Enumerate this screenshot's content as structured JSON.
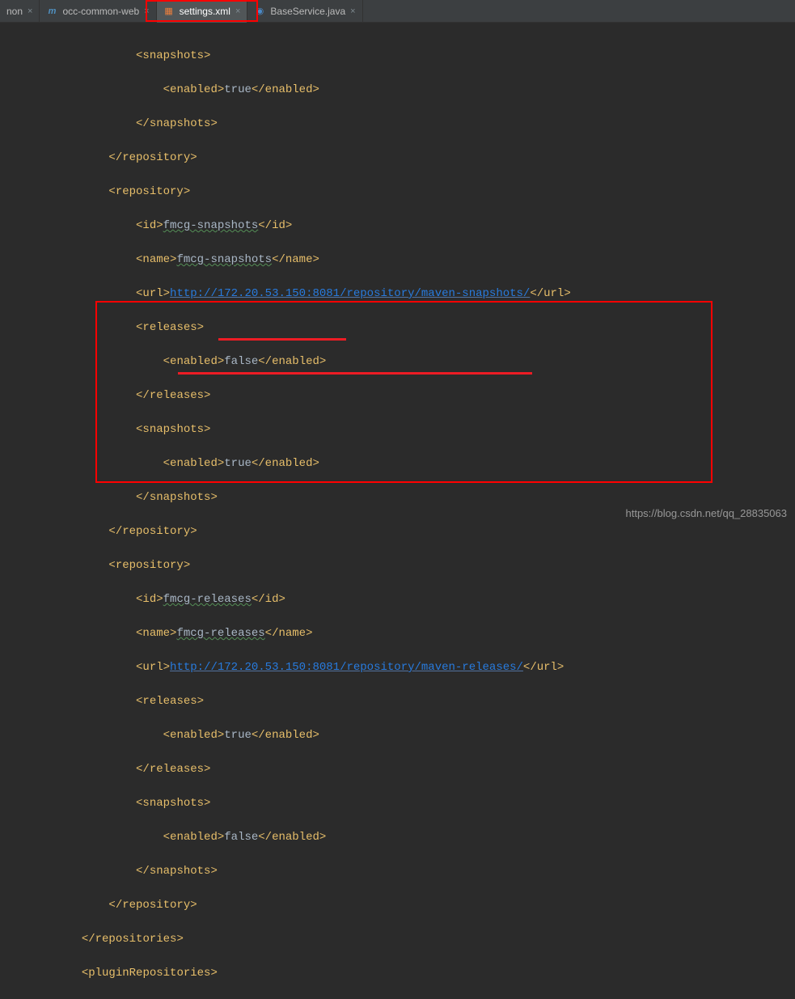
{
  "tabs": [
    {
      "label": "non",
      "icon": "",
      "close": "×"
    },
    {
      "label": "occ-common-web",
      "icon": "m",
      "close": "×"
    },
    {
      "label": "settings.xml",
      "icon": "xml",
      "close": "×",
      "active": true
    },
    {
      "label": "BaseService.java",
      "icon": "java",
      "close": "×"
    }
  ],
  "code": {
    "l1": {
      "tag_open": "<snapshots>",
      "indent": "                    "
    },
    "l2": {
      "tag_open": "<enabled>",
      "text": "true",
      "tag_close": "</enabled>",
      "indent": "                        "
    },
    "l3": {
      "tag_close": "</snapshots>",
      "indent": "                    "
    },
    "l4": {
      "tag_close": "</repository>",
      "indent": "                "
    },
    "l5": {
      "tag_open": "<repository>",
      "indent": "                "
    },
    "l6": {
      "tag_open": "<id>",
      "text": "fmcg-snapshots",
      "tag_close": "</id>",
      "indent": "                    "
    },
    "l7": {
      "tag_open": "<name>",
      "text": "fmcg-snapshots",
      "tag_close": "</name>",
      "indent": "                    "
    },
    "l8": {
      "tag_open": "<url>",
      "url": "http://172.20.53.150:8081/repository/maven-snapshots/",
      "tag_close": "</url>",
      "indent": "                    "
    },
    "l9": {
      "tag_open": "<releases>",
      "indent": "                    "
    },
    "l10": {
      "tag_open": "<enabled>",
      "text": "false",
      "tag_close": "</enabled>",
      "indent": "                        "
    },
    "l11": {
      "tag_close": "</releases>",
      "indent": "                    "
    },
    "l12": {
      "tag_open": "<snapshots>",
      "indent": "                    "
    },
    "l13": {
      "tag_open": "<enabled>",
      "text": "true",
      "tag_close": "</enabled>",
      "indent": "                        "
    },
    "l14": {
      "tag_close": "</snapshots>",
      "indent": "                    "
    },
    "l15": {
      "tag_close": "</repository>",
      "indent": "                "
    },
    "l16": {
      "tag_open": "<repository>",
      "indent": "                "
    },
    "l17": {
      "tag_open": "<id>",
      "text": "fmcg-releases",
      "tag_close": "</id>",
      "indent": "                    "
    },
    "l18": {
      "tag_open": "<name>",
      "text": "fmcg-releases",
      "tag_close": "</name>",
      "indent": "                    "
    },
    "l19": {
      "tag_open": "<url>",
      "url": "http://172.20.53.150:8081/repository/maven-releases/",
      "tag_close": "</url>",
      "indent": "                    "
    },
    "l20": {
      "tag_open": "<releases>",
      "indent": "                    "
    },
    "l21": {
      "tag_open": "<enabled>",
      "text": "true",
      "tag_close": "</enabled>",
      "indent": "                        "
    },
    "l22": {
      "tag_close": "</releases>",
      "indent": "                    "
    },
    "l23": {
      "tag_open": "<snapshots>",
      "indent": "                    "
    },
    "l24": {
      "tag_open": "<enabled>",
      "text": "false",
      "tag_close": "</enabled>",
      "indent": "                        "
    },
    "l25": {
      "tag_close": "</snapshots>",
      "indent": "                    "
    },
    "l26": {
      "tag_close": "</repository>",
      "indent": "                "
    },
    "l27": {
      "tag_close": "</repositories>",
      "indent": "            "
    },
    "l28": {
      "tag_open": "<pluginRepositories>",
      "indent": "            "
    }
  },
  "watermark": "https://blog.csdn.net/qq_28835063"
}
